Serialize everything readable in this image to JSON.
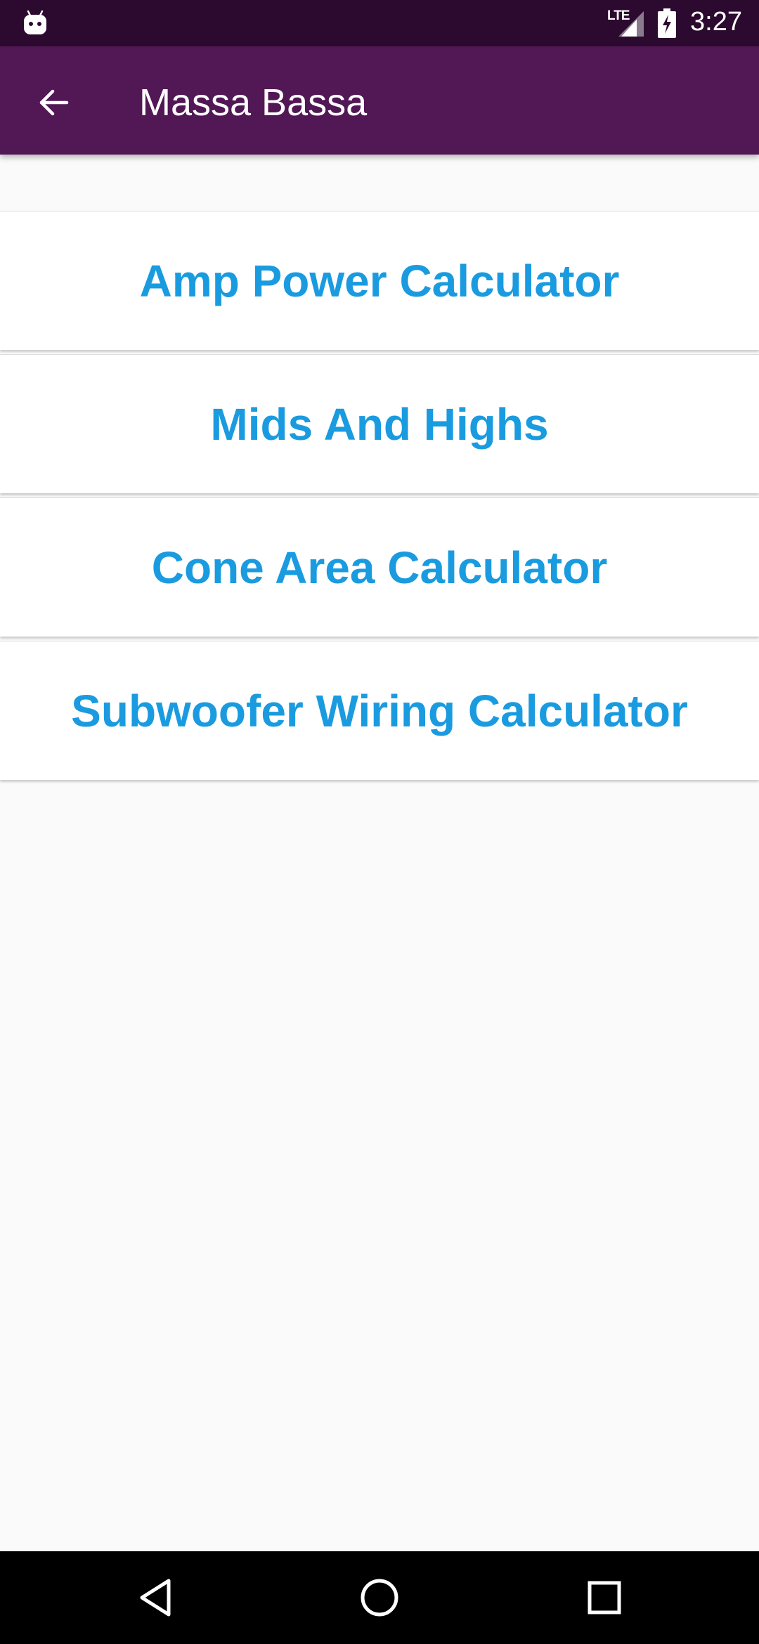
{
  "status_bar": {
    "time": "3:27",
    "network": "LTE",
    "icons": [
      "android-icon",
      "signal-icon",
      "battery-charging-icon"
    ]
  },
  "app_bar": {
    "title": "Massa Bassa",
    "back_icon": "arrow-left-icon",
    "background": "#521755"
  },
  "menu": {
    "items": [
      {
        "label": "Amp Power Calculator"
      },
      {
        "label": "Mids And Highs"
      },
      {
        "label": "Cone Area Calculator"
      },
      {
        "label": "Subwoofer Wiring Calculator"
      }
    ],
    "text_color": "#1a9be0"
  },
  "nav_bar": {
    "icons": [
      "back-triangle-icon",
      "home-circle-icon",
      "recents-square-icon"
    ]
  }
}
